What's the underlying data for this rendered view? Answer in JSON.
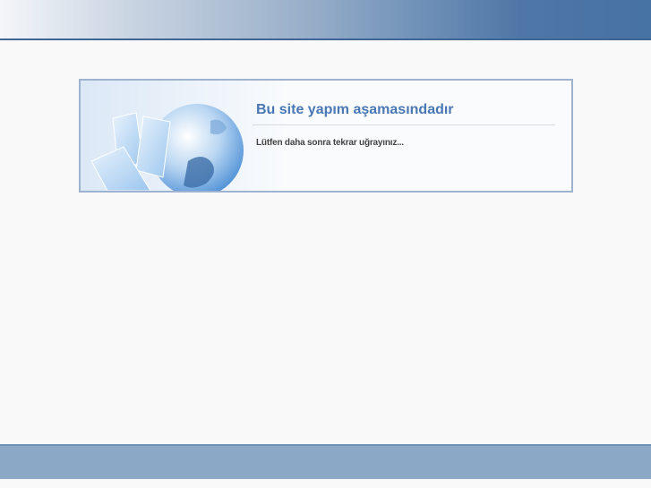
{
  "notice": {
    "title": "Bu site yapım aşamasındadır",
    "message": "Lütfen daha sonra tekrar uğrayınız..."
  },
  "colors": {
    "accent": "#4a78b4",
    "header": "#4672a4",
    "footer": "#8ba9c7"
  }
}
